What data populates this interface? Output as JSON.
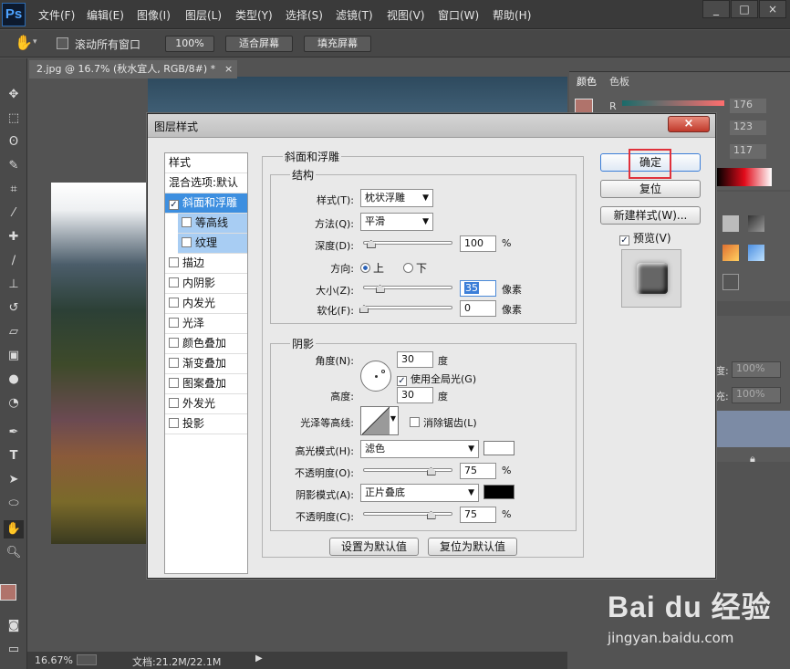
{
  "menu": {
    "logo": "Ps",
    "items": [
      "文件(F)",
      "编辑(E)",
      "图像(I)",
      "图层(L)",
      "类型(Y)",
      "选择(S)",
      "滤镜(T)",
      "视图(V)",
      "窗口(W)",
      "帮助(H)"
    ],
    "window_buttons": [
      "_",
      "□",
      "×"
    ]
  },
  "options_bar": {
    "scroll_all_label": "滚动所有窗口",
    "zoom_button": "100%",
    "fit_screen": "适合屏幕",
    "fill_screen": "填充屏幕"
  },
  "document": {
    "tab_title": "2.jpg @ 16.7% (秋水宜人, RGB/8#) *",
    "tab_close": "×",
    "zoom": "16.67%",
    "doc_info": "文档:21.2M/22.1M"
  },
  "right_panel": {
    "tab_color": "颜色",
    "tab_swatches": "色板",
    "channel_r": "R",
    "values": [
      "176",
      "123",
      "117"
    ],
    "opacity_label": "度:",
    "opacity_value": "100%",
    "fill_label": "充:",
    "fill_value": "100%"
  },
  "dialog": {
    "title": "图层样式",
    "close": "×",
    "style_list": [
      {
        "label": "样式",
        "checkbox": false,
        "checked": false,
        "state": "normal"
      },
      {
        "label": "混合选项:默认",
        "checkbox": false,
        "checked": false,
        "state": "normal"
      },
      {
        "label": "斜面和浮雕",
        "checkbox": true,
        "checked": true,
        "state": "selected"
      },
      {
        "label": "等高线",
        "checkbox": true,
        "checked": false,
        "state": "sub"
      },
      {
        "label": "纹理",
        "checkbox": true,
        "checked": false,
        "state": "sub"
      },
      {
        "label": "描边",
        "checkbox": true,
        "checked": false,
        "state": "normal"
      },
      {
        "label": "内阴影",
        "checkbox": true,
        "checked": false,
        "state": "normal"
      },
      {
        "label": "内发光",
        "checkbox": true,
        "checked": false,
        "state": "normal"
      },
      {
        "label": "光泽",
        "checkbox": true,
        "checked": false,
        "state": "normal"
      },
      {
        "label": "颜色叠加",
        "checkbox": true,
        "checked": false,
        "state": "normal"
      },
      {
        "label": "渐变叠加",
        "checkbox": true,
        "checked": false,
        "state": "normal"
      },
      {
        "label": "图案叠加",
        "checkbox": true,
        "checked": false,
        "state": "normal"
      },
      {
        "label": "外发光",
        "checkbox": true,
        "checked": false,
        "state": "normal"
      },
      {
        "label": "投影",
        "checkbox": true,
        "checked": false,
        "state": "normal"
      }
    ],
    "bevel": {
      "section_title": "斜面和浮雕",
      "structure_title": "结构",
      "style_label": "样式(T):",
      "style_value": "枕状浮雕",
      "technique_label": "方法(Q):",
      "technique_value": "平滑",
      "depth_label": "深度(D):",
      "depth_value": "100",
      "depth_unit": "%",
      "depth_fraction": 0.08,
      "direction_label": "方向:",
      "direction_up": "上",
      "direction_down": "下",
      "size_label": "大小(Z):",
      "size_value": "35",
      "size_unit": "像素",
      "size_fraction": 0.18,
      "soften_label": "软化(F):",
      "soften_value": "0",
      "soften_unit": "像素",
      "soften_fraction": 0.0
    },
    "shading": {
      "title": "阴影",
      "angle_label": "角度(N):",
      "angle_value": "30",
      "angle_unit": "度",
      "global_light_label": "使用全局光(G)",
      "global_light_checked": true,
      "altitude_label": "高度:",
      "altitude_value": "30",
      "altitude_unit": "度",
      "gloss_contour_label": "光泽等高线:",
      "anti_alias_label": "消除锯齿(L)",
      "highlight_mode_label": "高光模式(H):",
      "highlight_mode_value": "滤色",
      "highlight_color": "#ffffff",
      "highlight_opacity_label": "不透明度(O):",
      "highlight_opacity_value": "75",
      "highlight_opacity_fraction": 0.75,
      "shadow_mode_label": "阴影模式(A):",
      "shadow_mode_value": "正片叠底",
      "shadow_color": "#000000",
      "shadow_opacity_label": "不透明度(C):",
      "shadow_opacity_value": "75",
      "shadow_opacity_fraction": 0.75,
      "percent": "%"
    },
    "set_default": "设置为默认值",
    "reset_default": "复位为默认值",
    "ok": "确定",
    "reset": "复位",
    "new_style": "新建样式(W)...",
    "preview_label": "预览(V)",
    "preview_checked": true
  },
  "watermark": {
    "brand": "Bai du 经验",
    "url": "jingyan.baidu.com"
  },
  "colors": {
    "foreground": "#b0736b",
    "selection": "#3d8fe0",
    "highlight_box": "#e0323c"
  }
}
